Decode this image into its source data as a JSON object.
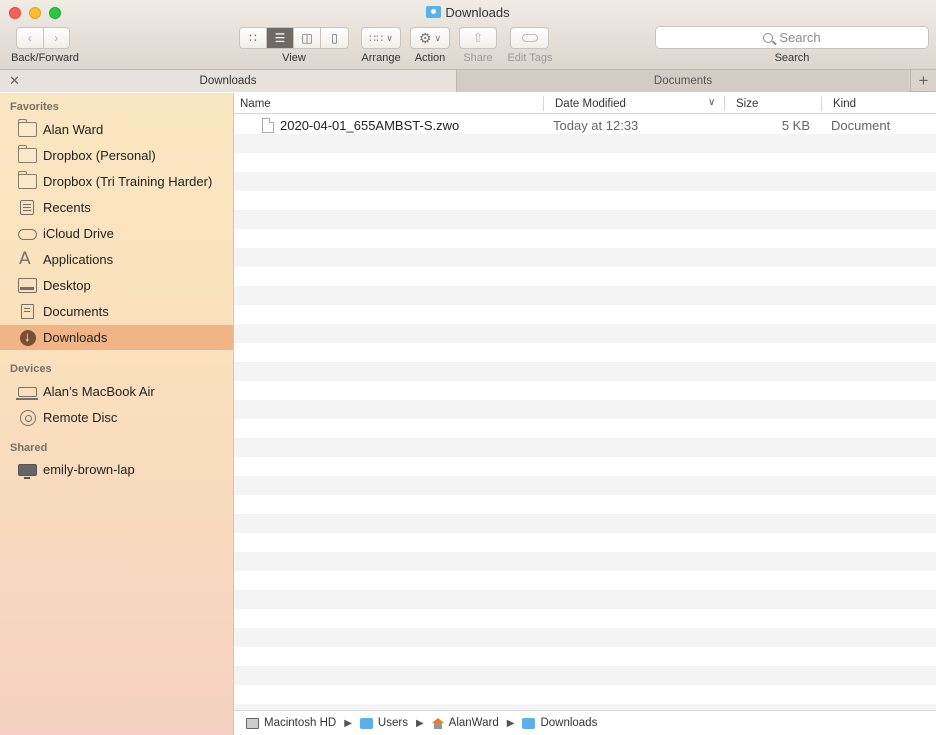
{
  "window": {
    "title": "Downloads"
  },
  "toolbar": {
    "nav_label": "Back/Forward",
    "view_label": "View",
    "arrange_label": "Arrange",
    "action_label": "Action",
    "share_label": "Share",
    "edit_tags_label": "Edit Tags",
    "search_placeholder": "Search",
    "search_label": "Search"
  },
  "tabs": [
    {
      "label": "Downloads",
      "active": true
    },
    {
      "label": "Documents",
      "active": false
    }
  ],
  "sidebar": {
    "favorites_heading": "Favorites",
    "favorites": [
      {
        "label": "Alan Ward",
        "icon": "folder-icon"
      },
      {
        "label": "Dropbox (Personal)",
        "icon": "folder-icon"
      },
      {
        "label": "Dropbox (Tri Training Harder)",
        "icon": "folder-icon"
      },
      {
        "label": "Recents",
        "icon": "recents-icon"
      },
      {
        "label": "iCloud Drive",
        "icon": "cloud-icon"
      },
      {
        "label": "Applications",
        "icon": "applications-icon"
      },
      {
        "label": "Desktop",
        "icon": "desktop-icon"
      },
      {
        "label": "Documents",
        "icon": "documents-icon"
      },
      {
        "label": "Downloads",
        "icon": "downloads-icon",
        "selected": true
      }
    ],
    "devices_heading": "Devices",
    "devices": [
      {
        "label": "Alan’s MacBook Air",
        "icon": "laptop-icon"
      },
      {
        "label": "Remote Disc",
        "icon": "disc-icon"
      }
    ],
    "shared_heading": "Shared",
    "shared": [
      {
        "label": "emily-brown-lap",
        "icon": "monitor-icon"
      }
    ]
  },
  "filelist": {
    "columns": {
      "name": "Name",
      "date": "Date Modified",
      "size": "Size",
      "kind": "Kind"
    },
    "rows": [
      {
        "name": "2020-04-01_655AMBST-S.zwo",
        "date": "Today at 12:33",
        "size": "5 KB",
        "kind": "Document"
      }
    ]
  },
  "pathbar": {
    "items": [
      "Macintosh HD",
      "Users",
      "AlanWard",
      "Downloads"
    ]
  },
  "colors": {
    "selection": "#f1b486",
    "sidebar_top": "#fbe6c2",
    "folder_accent": "#5ab0ea"
  }
}
